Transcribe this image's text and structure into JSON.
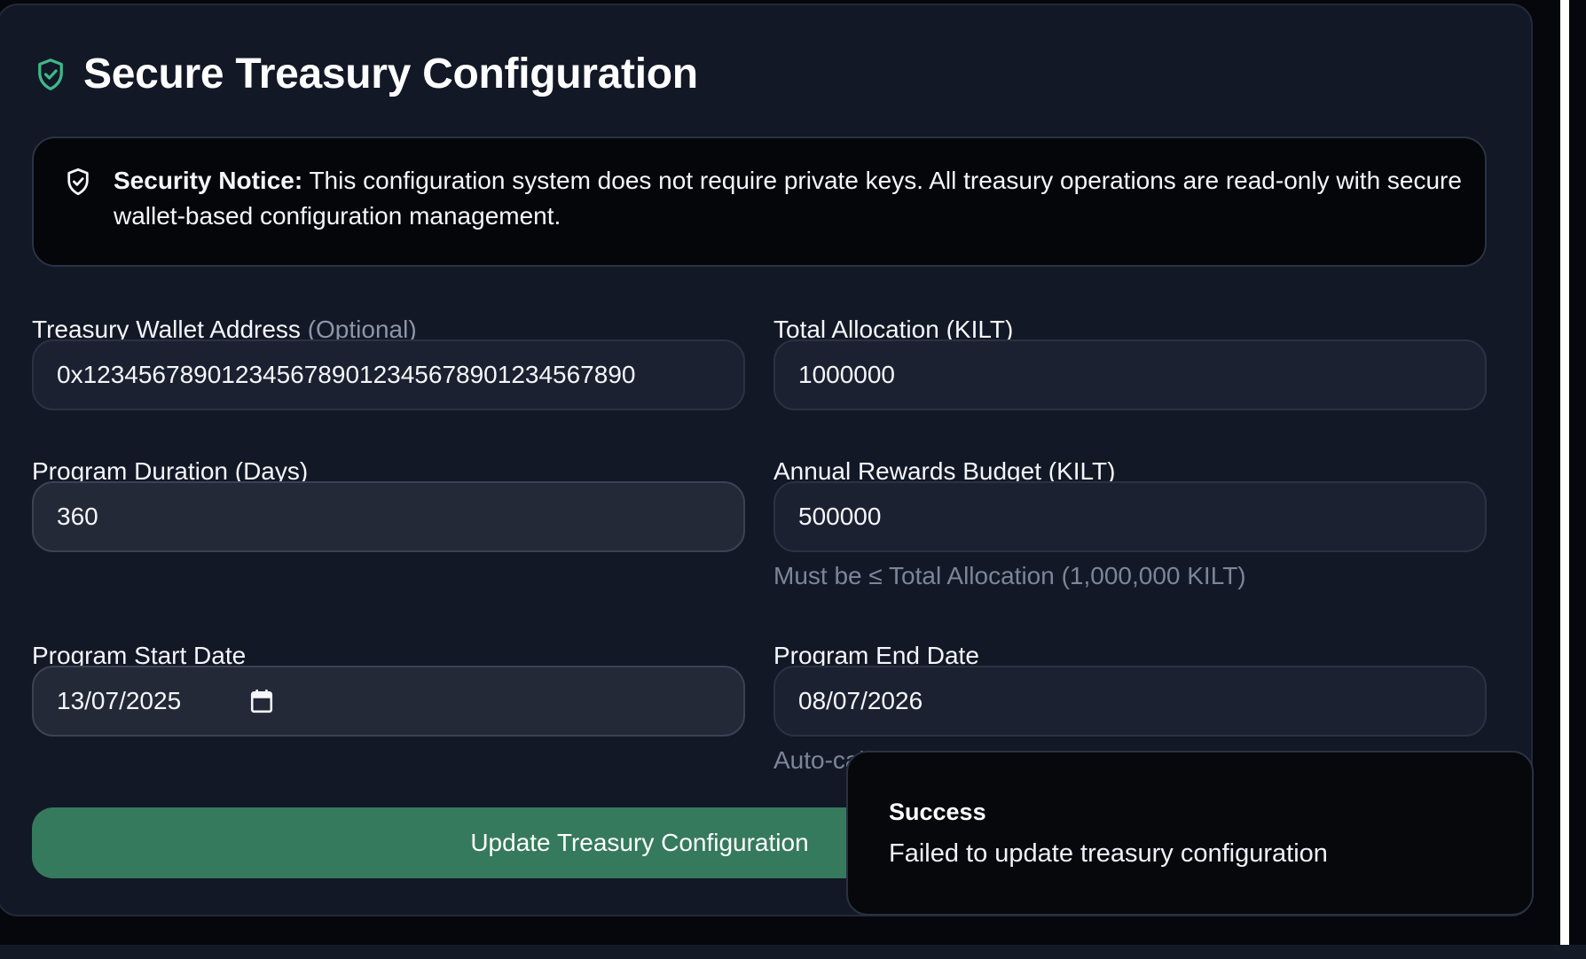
{
  "page": {
    "title": "Secure Treasury Configuration",
    "title_icon": "shield-check-icon"
  },
  "notice": {
    "icon": "shield-check-icon",
    "label": "Security Notice:",
    "text": " This configuration system does not require private keys. All treasury operations are read-only with secure wallet-based configuration management."
  },
  "fields": {
    "wallet": {
      "label": "Treasury Wallet Address",
      "optional": "(Optional)",
      "value": "0x1234567890123456789012345678901234567890"
    },
    "allocation": {
      "label": "Total Allocation (KILT)",
      "value": "1000000"
    },
    "duration": {
      "label": "Program Duration (Days)",
      "value": "360"
    },
    "budget": {
      "label": "Annual Rewards Budget (KILT)",
      "value": "500000",
      "hint": "Must be ≤ Total Allocation (1,000,000 KILT)"
    },
    "start_date": {
      "label": "Program Start Date",
      "value": "13/07/2025",
      "icon": "calendar-icon"
    },
    "end_date": {
      "label": "Program End Date",
      "value": "08/07/2026",
      "hint": "Auto-calculated from Start Date + Duration"
    }
  },
  "submit": {
    "label": "Update Treasury Configuration"
  },
  "toast": {
    "title": "Success",
    "description": "Failed to update treasury configuration"
  },
  "colors": {
    "accent_green": "#357a5c",
    "icon_green": "#3fb98a",
    "card_bg": "#121826",
    "input_bg": "#1b2130"
  }
}
